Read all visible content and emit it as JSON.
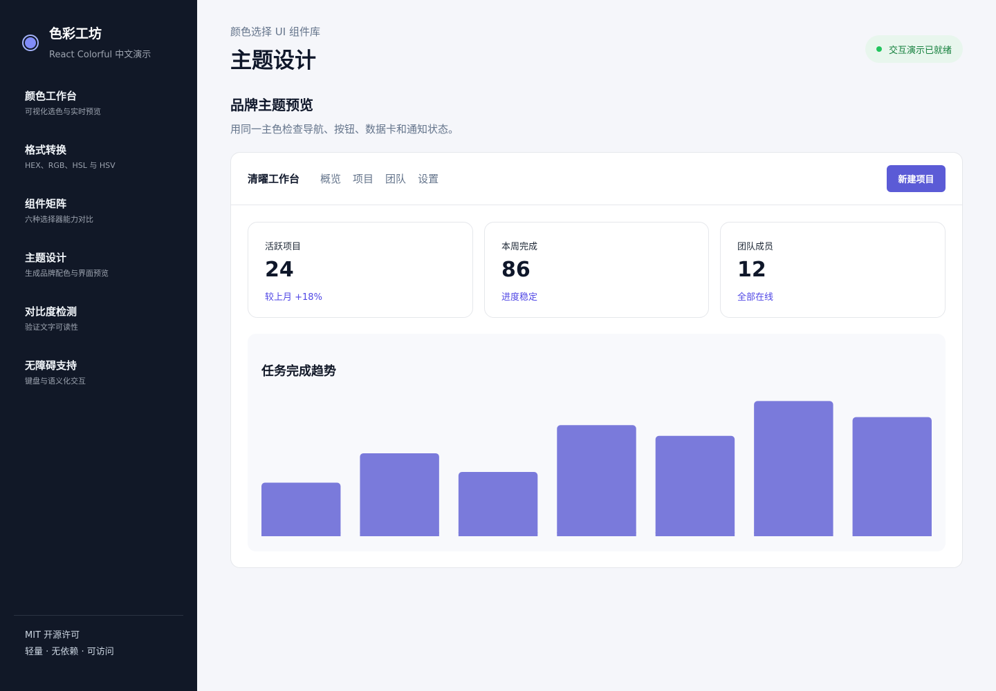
{
  "sidebar": {
    "brand_title": "色彩工坊",
    "brand_sub": "React Colorful 中文演示",
    "items": [
      {
        "title": "颜色工作台",
        "desc": "可视化选色与实时预览"
      },
      {
        "title": "格式转换",
        "desc": "HEX、RGB、HSL 与 HSV"
      },
      {
        "title": "组件矩阵",
        "desc": "六种选择器能力对比"
      },
      {
        "title": "主题设计",
        "desc": "生成品牌配色与界面预览"
      },
      {
        "title": "对比度检测",
        "desc": "验证文字可读性"
      },
      {
        "title": "无障碍支持",
        "desc": "键盘与语义化交互"
      }
    ],
    "footer_line1": "MIT 开源许可",
    "footer_line2": "轻量 · 无依赖 · 可访问"
  },
  "header": {
    "breadcrumb": "颜色选择 UI 组件库",
    "title": "主题设计",
    "status": "交互演示已就绪"
  },
  "section": {
    "title": "品牌主题预览",
    "desc": "用同一主色检查导航、按钮、数据卡和通知状态。"
  },
  "preview": {
    "app_name": "清曜工作台",
    "tabs": [
      "概览",
      "项目",
      "团队",
      "设置"
    ],
    "new_button": "新建项目",
    "stats": [
      {
        "label": "活跃项目",
        "value": "24",
        "note": "较上月 +18%"
      },
      {
        "label": "本周完成",
        "value": "86",
        "note": "进度稳定"
      },
      {
        "label": "团队成员",
        "value": "12",
        "note": "全部在线"
      }
    ],
    "chart_title": "任务完成趋势"
  },
  "colors": {
    "sidebar_bg": "#111827",
    "accent": "#5b5bd6",
    "bar": "#7a7adb",
    "status_bg": "#e8f6ed",
    "status_text": "#15803d"
  },
  "chart_data": {
    "type": "bar",
    "title": "任务完成趋势",
    "values": [
      40,
      62,
      48,
      83,
      75,
      101,
      89
    ],
    "ylim": [
      0,
      110
    ],
    "grid": false
  }
}
